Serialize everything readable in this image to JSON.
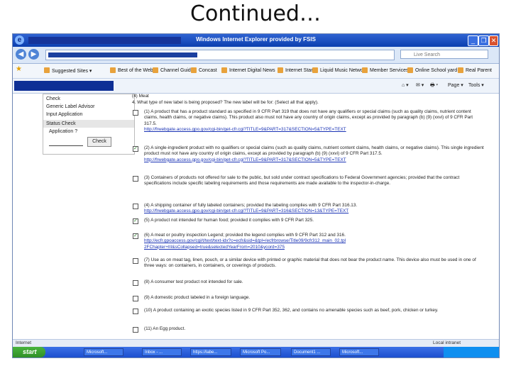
{
  "slide": {
    "title": "Continued…"
  },
  "window": {
    "title": "Windows Internet Explorer provided by FSIS",
    "min_glyph": "_",
    "max_glyph": "❐",
    "close_glyph": "✕"
  },
  "address": {
    "search_placeholder": "Live Search",
    "back_glyph": "◀",
    "forward_glyph": "▶"
  },
  "favorites": {
    "items": [
      "Suggested Sites ▾",
      "Best of the Web",
      "Channel Guide",
      "Concast",
      "Internet Digital News",
      "Internet Start",
      "Liquid Music Network",
      "Member Services",
      "Online School yard",
      "Real Parent"
    ]
  },
  "commands": {
    "items": [
      "⌂ ▾",
      "✉ ▾",
      "🖶 ▾",
      "Page ▾",
      "Tools ▾"
    ]
  },
  "sidepanel": {
    "items": [
      "Check",
      "Generic Label Advisor",
      "Input Application",
      "Status Check",
      "Application ?"
    ],
    "check_button": "Check"
  },
  "page": {
    "partial_top": "(4) Meat",
    "question": "4. What type of new label is being proposed? The new label will be for: (Select all that apply).",
    "options": [
      {
        "checked": false,
        "text": "(1) A product that has a product standard as specified in 9 CFR Part 319 that does not have any qualifiers or special claims (such as quality claims, nutrient content claims, health claims, or negative claims). This product also must not have any country of origin claims, except as provided by paragraph (b) (9) (xxvi) of 9 CFR Part 317.5.",
        "link": "http://frwebgate.access.gpo.gov/cgi-bin/get-cfr.cgi?TITLE=9&PART=317&SECTION=5&TYPE=TEXT"
      },
      {
        "checked": true,
        "text": "(2) A single-ingredient product with no qualifiers or special claims (such as quality claims, nutrient content claims, health claims, or negative claims). This single ingredient product must not have any country of origin claims, except as provided by paragraph (b) (9) (xxvi) of 9 CFR Part 317.5.",
        "link": "http://frwebgate.access.gpo.gov/cgi-bin/get-cfr.cgi?TITLE=9&PART=317&SECTION=5&TYPE=TEXT"
      },
      {
        "checked": false,
        "text": "(3) Containers of products not offered for sale to the public, but sold under contract specifications to Federal Government agencies; provided that the contract specifications include specific labeling requirements and those requirements are made available to the inspector-in-charge.",
        "link": ""
      },
      {
        "checked": false,
        "text": "(4) A shipping container of fully labeled containers; provided the labeling complies with 9 CFR Part 316.13.",
        "link": "http://frwebgate.access.gpo.gov/cgi-bin/get-cfr.cgi?TITLE=9&PART=316&SECTION=13&TYPE=TEXT"
      },
      {
        "checked": true,
        "text": "(5) A product not intended for human food; provided it complies with 9 CFR Part 325.",
        "link": ""
      },
      {
        "checked": true,
        "text": "(6) A meat or poultry inspection Legend; provided the legend complies with 9 CFR Part 312 and 316.",
        "link": "http://ecfr.gpoaccess.gov/cgi/t/text/text-idx?c=ecfr&sid=&tpl=/ecfrbrowse/Title09/9cfr312_main_02.tpl",
        "link2": "2FChapter+III&sCollapsed=true&selectedYearFrom=2010&ycord=375"
      },
      {
        "checked": false,
        "text": "(7) Use as on meat tag, linen, pouch, or a similar device with printed or graphic material that does not bear the product name. This device also must be used in one of three ways: on containers, in containers, or coverings of products.",
        "link": ""
      },
      {
        "checked": false,
        "text": "(8) A consumer test product not intended for sale.",
        "link": ""
      },
      {
        "checked": false,
        "text": "(9) A domestic product labeled in a foreign language.",
        "link": ""
      },
      {
        "checked": false,
        "text": "(10) A product containing an exotic species listed in 9 CFR Part 352, 362, and contains no amenable species such as beef, pork, chicken or turkey.",
        "link": ""
      },
      {
        "checked": false,
        "text": "(11) An Egg product.",
        "link": ""
      }
    ]
  },
  "status": {
    "left": "Internet",
    "right": "Local intranet"
  },
  "taskbar": {
    "start": "start",
    "tasks": [
      "Microsoft...",
      "Inbox - ...",
      "https://labe...",
      "Microsoft Po...",
      "Document1 ...",
      "Microsoft..."
    ]
  },
  "colors": {
    "titlebar": "#1447c0",
    "link": "#1a33b5",
    "check": "#1e7a1e"
  }
}
